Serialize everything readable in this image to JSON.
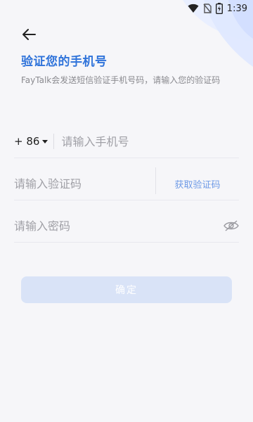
{
  "status_bar": {
    "time": "1:39",
    "icons": [
      "wifi-icon",
      "sim-off-icon",
      "battery-charging-icon"
    ]
  },
  "header": {
    "back_icon": "arrow-left-icon",
    "title": "验证您的手机号",
    "subtitle": "FayTalk会发送短信验证手机号码，请输入您的验证码"
  },
  "phone": {
    "country_code": "+ 86",
    "placeholder": "请输入手机号"
  },
  "code": {
    "placeholder": "请输入验证码",
    "get_code_label": "获取验证码"
  },
  "password": {
    "placeholder": "请输入密码",
    "toggle_icon": "eye-off-icon"
  },
  "confirm_label": "确定",
  "colors": {
    "background": "#f6f6f9",
    "accent": "#2f73da",
    "link": "#6f9be6",
    "button_disabled": "#d9e3f7"
  }
}
